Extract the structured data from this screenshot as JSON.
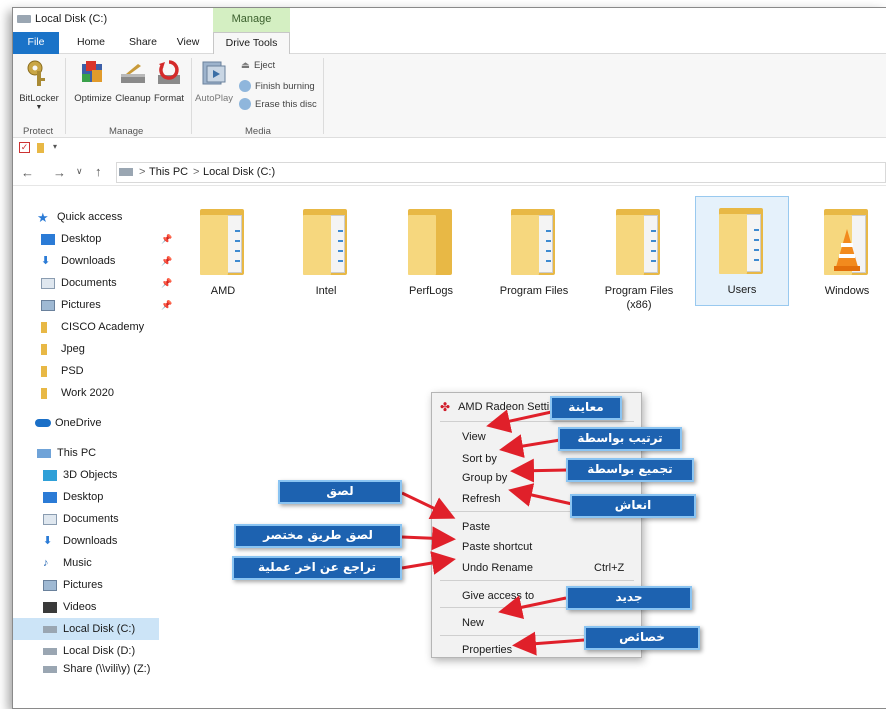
{
  "window": {
    "title": "Local Disk (C:)"
  },
  "ribbon_tabs": {
    "manage": "Manage",
    "file": "File",
    "home": "Home",
    "share": "Share",
    "view": "View",
    "drive_tools": "Drive Tools"
  },
  "ribbon": {
    "bitlocker": "BitLocker",
    "optimize": "Optimize",
    "cleanup": "Cleanup",
    "format": "Format",
    "autoplay": "AutoPlay",
    "eject": "Eject",
    "finish_burning": "Finish burning",
    "erase_disc": "Erase this disc",
    "group_protect": "Protect",
    "group_manage": "Manage",
    "group_media": "Media"
  },
  "address": {
    "this_pc": "This PC",
    "sep": ">",
    "current": "Local Disk (C:)"
  },
  "nav": {
    "quick_access": "Quick access",
    "desktop": "Desktop",
    "downloads": "Downloads",
    "documents": "Documents",
    "pictures": "Pictures",
    "cisco": "CISCO Academy",
    "jpeg": "Jpeg",
    "psd": "PSD",
    "work": "Work 2020",
    "onedrive": "OneDrive",
    "this_pc": "This PC",
    "objects3d": "3D Objects",
    "desktop2": "Desktop",
    "documents2": "Documents",
    "downloads2": "Downloads",
    "music": "Music",
    "pictures2": "Pictures",
    "videos": "Videos",
    "disk_c": "Local Disk (C:)",
    "disk_d": "Local Disk (D:)",
    "share": "Share (\\\\vili\\y) (Z:)"
  },
  "folders": [
    "AMD",
    "Intel",
    "PerfLogs",
    "Program Files",
    "Program Files\n(x86)",
    "Users",
    "Windows"
  ],
  "context_menu": {
    "amd": "AMD Radeon Setti",
    "view": "View",
    "sort_by": "Sort by",
    "group_by": "Group by",
    "refresh": "Refresh",
    "paste": "Paste",
    "paste_shortcut": "Paste shortcut",
    "undo_rename": "Undo Rename",
    "undo_shortcut": "Ctrl+Z",
    "give_access": "Give access to",
    "new": "New",
    "properties": "Properties"
  },
  "callouts": {
    "view": "معاينة",
    "sort": "ترتيب بواسطة",
    "group": "تجميع بواسطة",
    "refresh": "انعاش",
    "paste": "لصق",
    "paste_shortcut": "لصق طريق مختصر",
    "undo": "تراجع عن اخر عملية",
    "new": "جديد",
    "properties": "خصائص"
  },
  "colors": {
    "accent": "#1a73c8",
    "folder": "#f6d77e",
    "callout": "#1d62b0",
    "arrow": "#e0202a",
    "manage_tab": "#d4efc2"
  }
}
